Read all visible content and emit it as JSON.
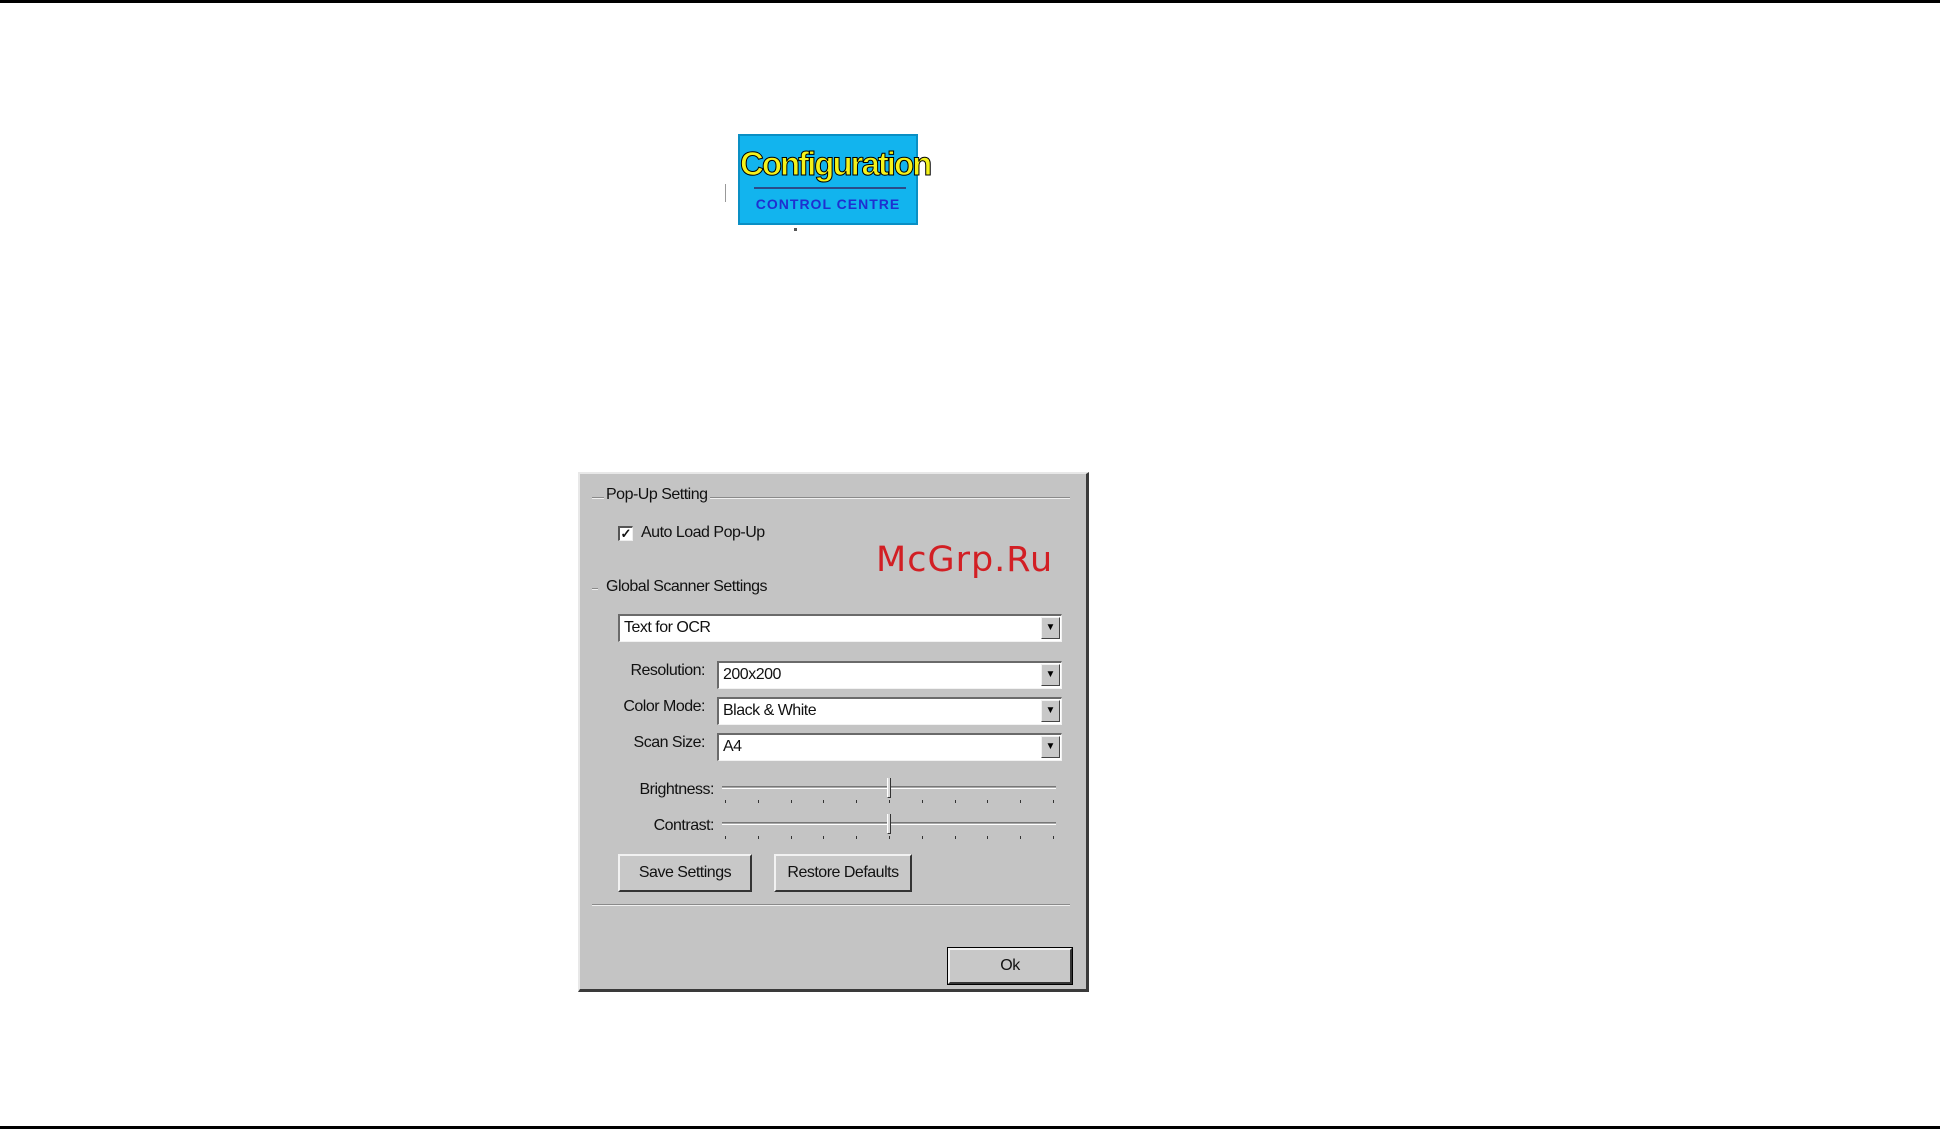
{
  "logo": {
    "title": "Configuration",
    "subtitle": "CONTROL CENTRE"
  },
  "dialog": {
    "popup_group": {
      "label": "Pop-Up Setting",
      "autoload_label": "Auto Load Pop-Up",
      "autoload_checked": true,
      "check_glyph": "✓"
    },
    "scanner_group": {
      "label": "Global Scanner Settings",
      "mode": "Text for OCR",
      "resolution_label": "Resolution:",
      "resolution_value": "200x200",
      "color_mode_label": "Color Mode:",
      "color_mode_value": "Black & White",
      "scan_size_label": "Scan Size:",
      "scan_size_value": "A4",
      "brightness_label": "Brightness:",
      "brightness_level": 0.5,
      "contrast_label": "Contrast:",
      "contrast_level": 0.5,
      "dropdown_glyph": "▼"
    },
    "save_settings_label": "Save Settings",
    "restore_defaults_label": "Restore Defaults",
    "ok_label": "Ok"
  },
  "watermark": "McGrp.Ru",
  "colors": {
    "logo_bg": "#12b4ee",
    "logo_title": "#f4f21a",
    "logo_subtitle": "#1f2fd0",
    "dialog_bg": "#c4c4c4",
    "watermark": "#d21f24"
  }
}
